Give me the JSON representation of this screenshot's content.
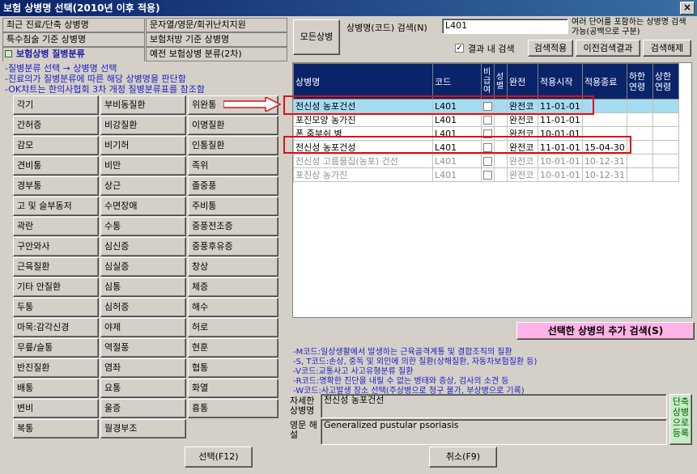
{
  "window": {
    "title": "보험 상병명 선택(2010년 이후 적용)",
    "close_glyph": "×"
  },
  "tabs": [
    {
      "label": "최근 진료/단축 상병명"
    },
    {
      "label": "문자열/영문/회귀난치지원"
    },
    {
      "label": "특수침술 기준 상병명"
    },
    {
      "label": "보험처방 기준 상병명"
    },
    {
      "label": "보험상병 질병분류"
    },
    {
      "label": "예전 보험상병 분류(2차)"
    }
  ],
  "info_lines": [
    "-질병분류 선택 → 상병명 선택",
    "-진료의가 질병분류에 따른 해당 상병명을 판단함",
    "-OK챠트는 한의사협회 3차 개정 질병분류표를 참조함"
  ],
  "categories": [
    [
      "각기",
      "부비동질환",
      "위완통"
    ],
    [
      "간허증",
      "비강질환",
      "이명질환"
    ],
    [
      "감모",
      "비기허",
      "인통질환"
    ],
    [
      "견비통",
      "비만",
      "족위"
    ],
    [
      "경부통",
      "상근",
      "졸중풍"
    ],
    [
      "고 및 슬부동저",
      "수면장애",
      "주비통"
    ],
    [
      "곽란",
      "수통",
      "중풍전조증"
    ],
    [
      "구안와사",
      "심신증",
      "중풍후유증"
    ],
    [
      "근육질환",
      "심실증",
      "창상"
    ],
    [
      "기타 안질환",
      "심통",
      "체증"
    ],
    [
      "두통",
      "심허증",
      "해수"
    ],
    [
      "마목:감각신경",
      "야제",
      "허로"
    ],
    [
      "무릎/슬통",
      "역절풍",
      "현훈"
    ],
    [
      "반진질환",
      "염좌",
      "협통"
    ],
    [
      "배통",
      "요통",
      "화열"
    ],
    [
      "변비",
      "울증",
      "흉통"
    ],
    [
      "복통",
      "월경부조",
      ""
    ]
  ],
  "search": {
    "all_button": "모든상병",
    "label": "상병명(코드) 검색(N)",
    "value": "L401",
    "hint": "여러 단어를 포함하는 상병명 검색 가능(공백으로 구분)",
    "within_checkbox": "결과 내 검색",
    "apply_button": "검색적용",
    "prev_button": "이전검색결과",
    "clear_button": "검색해제"
  },
  "table": {
    "headers": [
      "상병명",
      "코드",
      "비급여",
      "성별",
      "완전",
      "적용시작",
      "적용종료",
      "하한연령",
      "상한연령"
    ],
    "rows": [
      {
        "name": "전신성 농포건선",
        "code": "L401",
        "full": "완전코",
        "start": "11-01-01",
        "end": "",
        "dim": false,
        "selected": true
      },
      {
        "name": "포진모양 농가진",
        "code": "L401",
        "full": "완전코",
        "start": "11-01-01",
        "end": "",
        "dim": false,
        "selected": false
      },
      {
        "name": "폰 줌부쉬 병",
        "code": "L401",
        "full": "완전코",
        "start": "10-01-01",
        "end": "",
        "dim": false,
        "selected": false
      },
      {
        "name": "전신성 농포건성",
        "code": "L401",
        "full": "완전코",
        "start": "11-01-01",
        "end": "15-04-30",
        "dim": false,
        "selected": false
      },
      {
        "name": "전신성 고름물집(농포) 건선",
        "code": "L401",
        "full": "완전코",
        "start": "10-01-01",
        "end": "10-12-31",
        "dim": true,
        "selected": false
      },
      {
        "name": "포진상 농가진",
        "code": "L401",
        "full": "완전코",
        "start": "10-01-01",
        "end": "10-12-31",
        "dim": true,
        "selected": false
      }
    ]
  },
  "add_search_button": "선택한 상병의 추가 검색(S)",
  "legend": [
    "-M코드:일상생활에서 발생하는 근육골격계통 및 결합조직의 질환",
    "-S, T코드:손상, 중독 및 외인에 의한 질환(상해질환, 자동차보험질환 등)",
    "-V코드:교통사고 사고유형분류 질환",
    "-R코드:명확한 진단을 내릴 수 없는 병태와 증상, 검사의 소견 등",
    "-W코드:사고발생 장소 선택(주상병으로 청구 불가, 부상병으로 기록)"
  ],
  "detail": {
    "name_label": "자세한 상병명",
    "name_value": "전신성 농포건선",
    "en_label": "영문 해설",
    "en_value": "Generalized pustular psoriasis",
    "shortcut_button": "단축상병으로등록"
  },
  "footer": {
    "select_button": "선택(F12)",
    "cancel_button": "취소(F9)"
  },
  "colors": {
    "title_bar": "#0a246a",
    "selected_row": "#a6dcf0",
    "annotation": "#e01010",
    "add_button": "#ffb3e6",
    "shortcut_button": "#c6ecc6"
  }
}
